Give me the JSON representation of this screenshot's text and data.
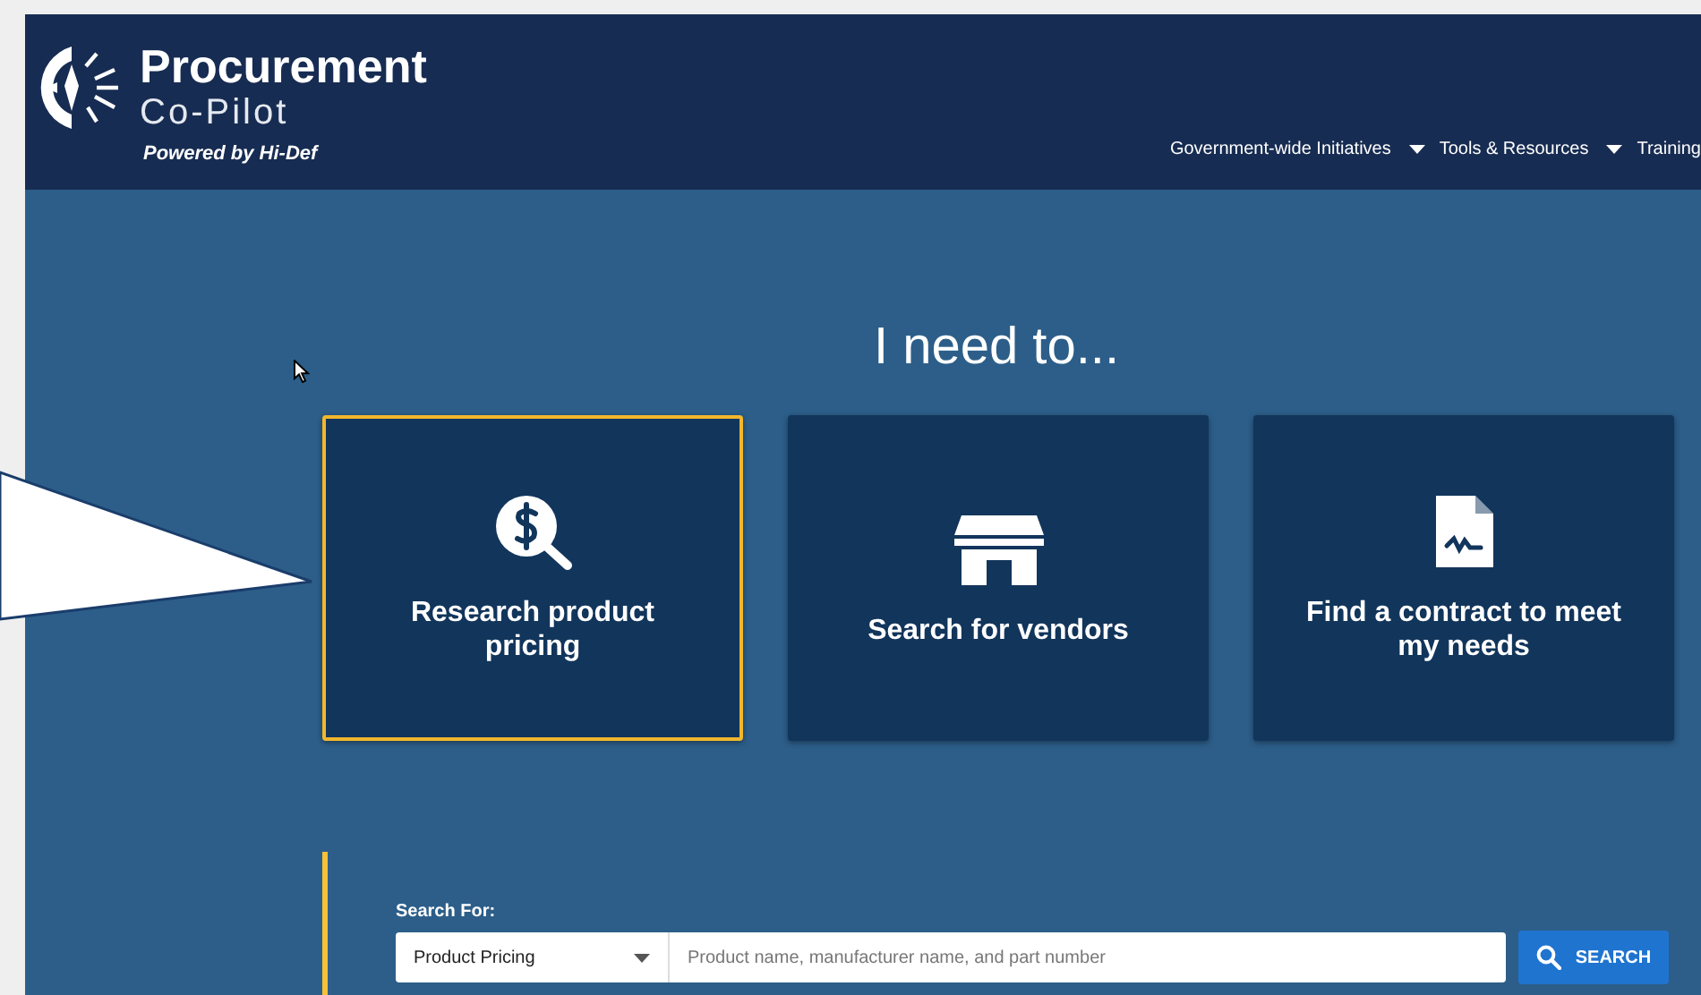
{
  "header": {
    "title": "Procurement",
    "subtitle": "Co-Pilot",
    "powered_by": "Powered by Hi-Def",
    "nav": [
      {
        "label": "Government-wide Initiatives",
        "has_dropdown": true
      },
      {
        "label": "Tools & Resources",
        "has_dropdown": true
      },
      {
        "label": "Training",
        "has_dropdown": false
      }
    ]
  },
  "heading": "I need to...",
  "cards": [
    {
      "kind": "pricing",
      "label": "Research product pricing",
      "selected": true
    },
    {
      "kind": "vendors",
      "label": "Search for vendors",
      "selected": false
    },
    {
      "kind": "contract",
      "label": "Find a contract to meet my needs",
      "selected": false
    }
  ],
  "search": {
    "label": "Search For:",
    "select_value": "Product Pricing",
    "placeholder": "Product name, manufacturer name, and part number",
    "button": "SEARCH"
  }
}
